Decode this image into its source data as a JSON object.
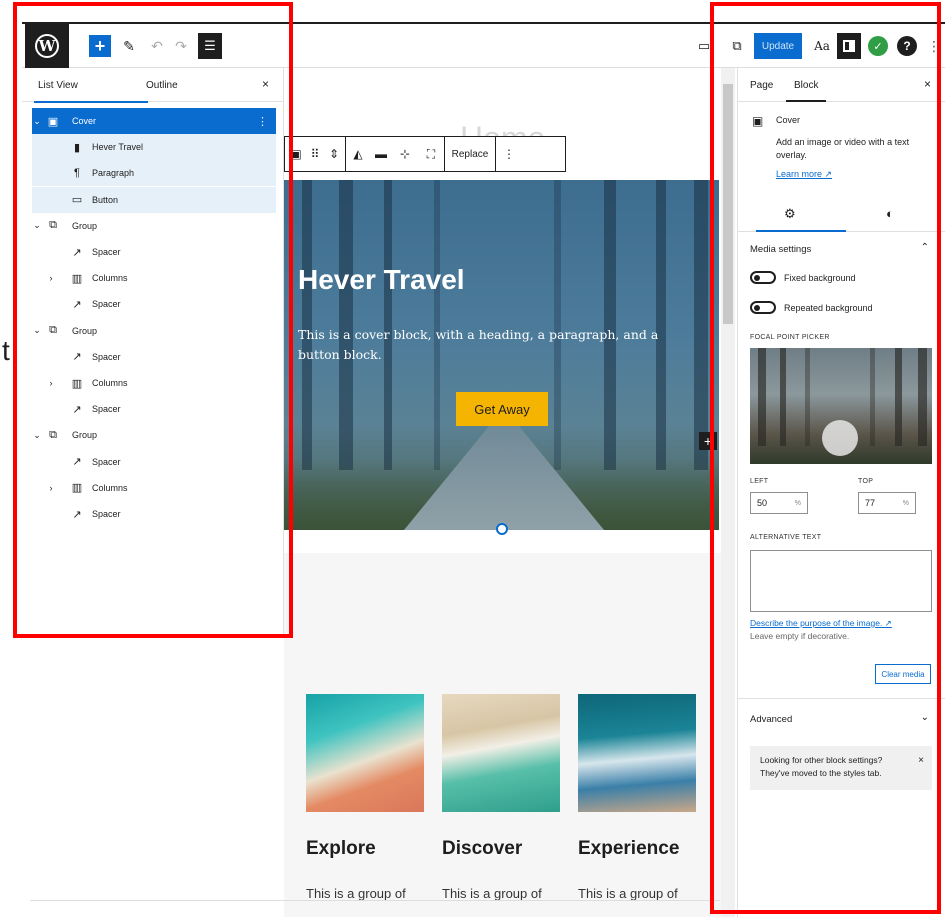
{
  "topbar": {
    "logo": "W",
    "add_icon": "+",
    "edit_icon": "✎",
    "undo_icon": "↶",
    "redo_icon": "↷",
    "listview_icon": "☰",
    "desktop_icon": "▭",
    "external_icon": "⧉",
    "update_label": "Update",
    "styles_icon": "Aa",
    "green_icon": "✓",
    "help_icon": "?",
    "more_icon": "⋮"
  },
  "listview": {
    "tabs": [
      "List View",
      "Outline"
    ],
    "close_icon": "×",
    "items": [
      {
        "label": "Cover",
        "icon": "▣",
        "chev": "⌄"
      },
      {
        "label": "Hever Travel",
        "icon": "▮",
        "chev": ""
      },
      {
        "label": "Paragraph",
        "icon": "¶",
        "chev": ""
      },
      {
        "label": "Button",
        "icon": "▭",
        "chev": ""
      },
      {
        "label": "Group",
        "icon": "⧉",
        "chev": "⌄"
      },
      {
        "label": "Spacer",
        "icon": "↗",
        "chev": ""
      },
      {
        "label": "Columns",
        "icon": "▥",
        "chev": "›"
      },
      {
        "label": "Spacer",
        "icon": "↗",
        "chev": ""
      },
      {
        "label": "Group",
        "icon": "⧉",
        "chev": "⌄"
      },
      {
        "label": "Spacer",
        "icon": "↗",
        "chev": ""
      },
      {
        "label": "Columns",
        "icon": "▥",
        "chev": "›"
      },
      {
        "label": "Spacer",
        "icon": "↗",
        "chev": ""
      },
      {
        "label": "Group",
        "icon": "⧉",
        "chev": "⌄"
      },
      {
        "label": "Spacer",
        "icon": "↗",
        "chev": ""
      },
      {
        "label": "Columns",
        "icon": "▥",
        "chev": "›"
      },
      {
        "label": "Spacer",
        "icon": "↗",
        "chev": ""
      }
    ],
    "menu_icon": "⋮"
  },
  "canvas": {
    "page_title": "Home",
    "toolbar": {
      "cover_icon": "▣",
      "drag_icon": "⠿",
      "move_icon": "⇕",
      "contrast_icon": "◭",
      "align_icon": "▬",
      "focal_icon": "⊹",
      "full_icon": "⛶",
      "replace_label": "Replace",
      "more_icon": "⋮"
    },
    "cover": {
      "heading": "Hever Travel",
      "paragraph": "This is a cover block, with a heading, a paragraph, and a button block.",
      "button": "Get Away",
      "add_icon": "+"
    },
    "columns": [
      {
        "title": "Explore",
        "text": "This is a group of"
      },
      {
        "title": "Discover",
        "text": "This is a group of"
      },
      {
        "title": "Experience",
        "text": "This is a group of"
      }
    ],
    "gutter_letter": "t"
  },
  "sidebar": {
    "tabs": [
      "Page",
      "Block"
    ],
    "close_icon": "×",
    "block": {
      "icon": "▣",
      "name": "Cover",
      "description": "Add an image or video with a text overlay.",
      "learn_more": "Learn more ↗"
    },
    "subtabs": {
      "settings_icon": "⚙",
      "styles_icon": "◐"
    },
    "media": {
      "title": "Media settings",
      "chevron": "⌃",
      "fixed_bg": "Fixed background",
      "repeated_bg": "Repeated background",
      "focal_caption": "FOCAL POINT PICKER",
      "left_label": "LEFT",
      "top_label": "TOP",
      "left_value": "50",
      "top_value": "77",
      "pct": "%",
      "alt_caption": "ALTERNATIVE TEXT",
      "alt_link": "Describe the purpose of the image. ↗",
      "alt_help": "Leave empty if decorative.",
      "clear_label": "Clear media"
    },
    "advanced": {
      "title": "Advanced",
      "chevron": "⌄"
    },
    "notice": {
      "text": "Looking for other block settings? They've moved to the styles tab.",
      "close_icon": "×"
    }
  }
}
